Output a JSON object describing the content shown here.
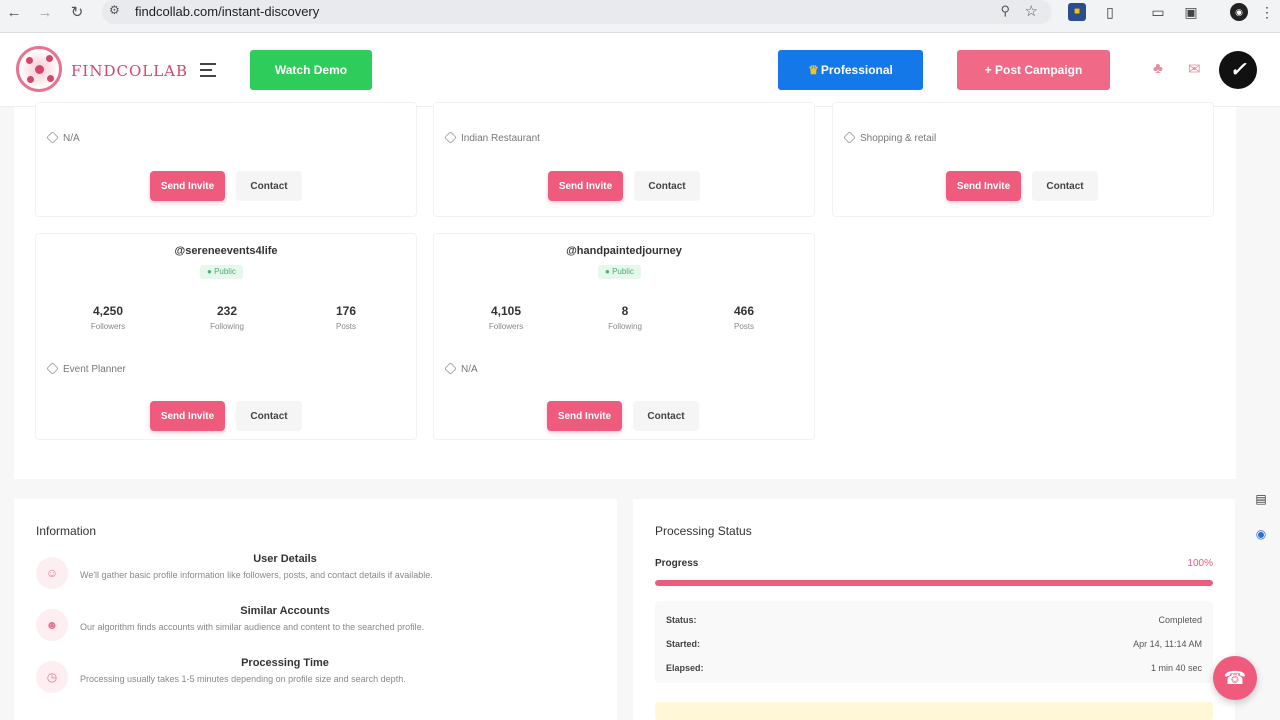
{
  "browser": {
    "url": "findcollab.com/instant-discovery",
    "back_icon": "arrow-left-icon",
    "forward_icon": "arrow-right-icon",
    "reload_icon": "reload-icon"
  },
  "header": {
    "logo_text": "FINDCOLLAB",
    "watch_demo_label": "Watch Demo",
    "professional_label": "Professional",
    "post_campaign_label": "+ Post Campaign"
  },
  "top_cards": [
    {
      "category": "N/A",
      "send_label": "Send Invite",
      "contact_label": "Contact"
    },
    {
      "category": "Indian Restaurant",
      "send_label": "Send Invite",
      "contact_label": "Contact"
    },
    {
      "category": "Shopping & retail",
      "send_label": "Send Invite",
      "contact_label": "Contact"
    }
  ],
  "profile_cards": [
    {
      "handle": "@sereneevents4life",
      "visibility": "Public",
      "followers": "4,250",
      "followers_label": "Followers",
      "following": "232",
      "following_label": "Following",
      "posts": "176",
      "posts_label": "Posts",
      "category": "Event Planner",
      "send_label": "Send Invite",
      "contact_label": "Contact"
    },
    {
      "handle": "@handpaintedjourney",
      "visibility": "Public",
      "followers": "4,105",
      "followers_label": "Followers",
      "following": "8",
      "following_label": "Following",
      "posts": "466",
      "posts_label": "Posts",
      "category": "N/A",
      "send_label": "Send Invite",
      "contact_label": "Contact"
    }
  ],
  "information": {
    "title": "Information",
    "items": [
      {
        "title": "User Details",
        "desc": "We'll gather basic profile information like followers, posts, and contact details if available.",
        "icon": "user-icon"
      },
      {
        "title": "Similar Accounts",
        "desc": "Our algorithm finds accounts with similar audience and content to the searched profile.",
        "icon": "users-icon"
      },
      {
        "title": "Processing Time",
        "desc": "Processing usually takes 1-5 minutes depending on profile size and search depth.",
        "icon": "clock-icon"
      }
    ]
  },
  "processing": {
    "title": "Processing Status",
    "progress_label": "Progress",
    "progress_value": 100,
    "progress_text": "100%",
    "status_key": "Status:",
    "status_value": "Completed",
    "started_key": "Started:",
    "started_value": "Apr 14, 11:14 AM",
    "elapsed_key": "Elapsed:",
    "elapsed_value": "1 min 40 sec"
  },
  "colors": {
    "brand_pink": "#ee5b7c",
    "watch_demo_green": "#2ecc5a",
    "professional_blue": "#1478e8",
    "public_green": "#4caf6e"
  }
}
